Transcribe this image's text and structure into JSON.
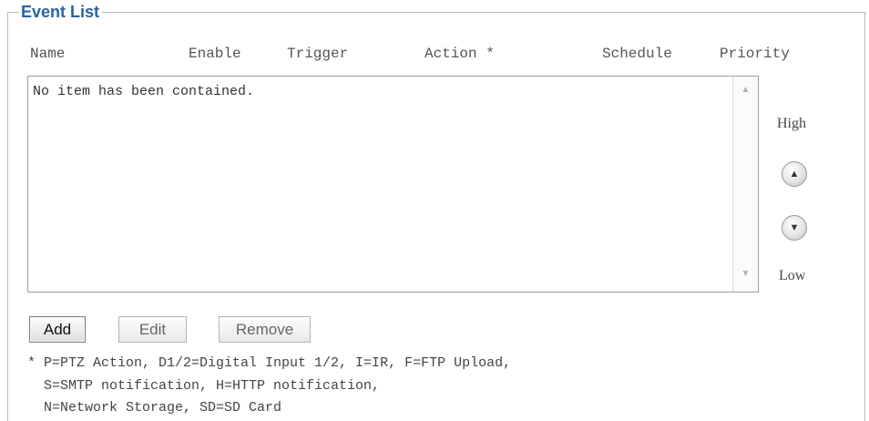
{
  "panel": {
    "title": "Event List"
  },
  "columns": {
    "name": "Name",
    "enable": "Enable",
    "trigger": "Trigger",
    "action": "Action *",
    "schedule": "Schedule",
    "priority": "Priority"
  },
  "list": {
    "empty_message": "No item has been contained.",
    "scroll_up_icon": "scroll-up-arrow",
    "scroll_down_icon": "scroll-down-arrow"
  },
  "priority_controls": {
    "high_label": "High",
    "low_label": "Low",
    "up_icon": "arrow-up-circle",
    "down_icon": "arrow-down-circle"
  },
  "buttons": {
    "add": "Add",
    "edit": "Edit",
    "remove": "Remove"
  },
  "legend_note": {
    "line1": "* P=PTZ Action, D1/2=Digital Input 1/2, I=IR, F=FTP Upload,",
    "line2": "S=SMTP notification, H=HTTP notification,",
    "line3": "N=Network Storage, SD=SD Card"
  },
  "colors": {
    "title_blue": "#2a63a6",
    "border_gray": "#b8b8b8"
  }
}
